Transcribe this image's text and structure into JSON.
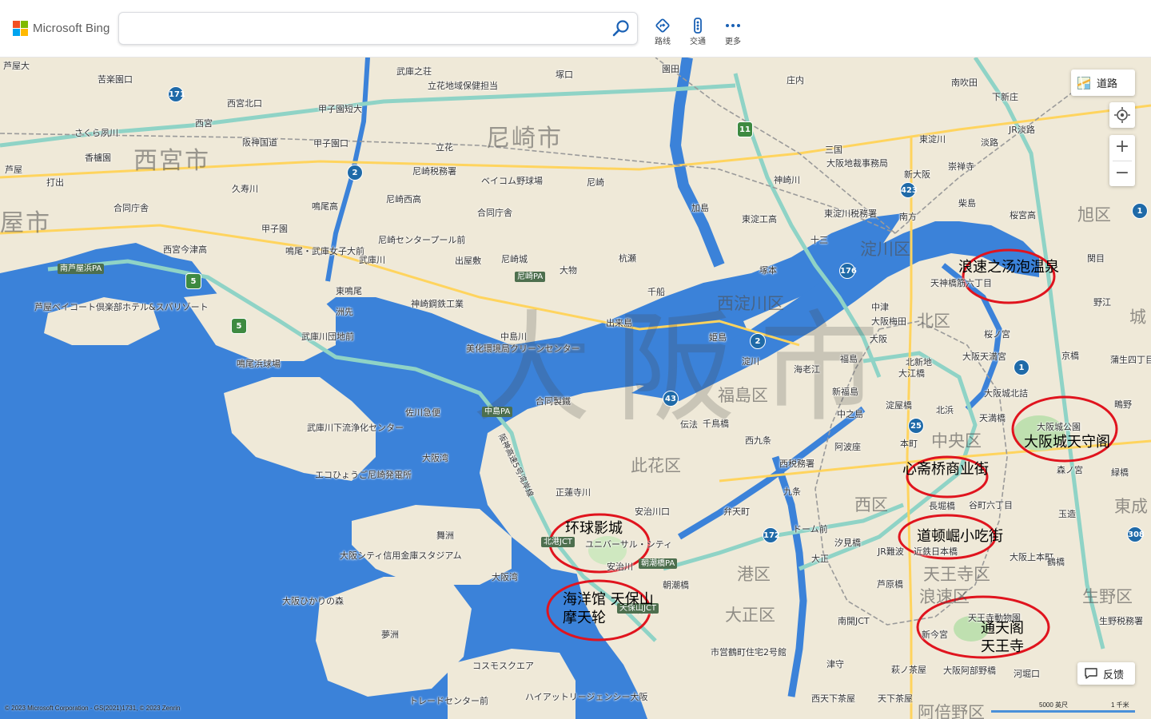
{
  "header": {
    "brand": "Microsoft Bing",
    "brand_colors": [
      "#f25022",
      "#7fba00",
      "#00a4ef",
      "#ffb900"
    ],
    "search": {
      "value": "",
      "placeholder": ""
    },
    "search_icon": "search-icon",
    "buttons": [
      {
        "label": "路线",
        "icon": "directions-icon"
      },
      {
        "label": "交通",
        "icon": "traffic-icon"
      },
      {
        "label": "更多",
        "icon": "more-icon"
      }
    ]
  },
  "map": {
    "style_button": "道路",
    "feedback": "反馈",
    "copyright": "© 2023 Microsoft Corporation - GS(2021)1731, © 2023 Zenrin",
    "scale": {
      "imperial": "5000 英尺",
      "metric": "1 千米"
    },
    "watermark": "大阪市",
    "cities": [
      "西宮市",
      "尼崎市",
      "屋市"
    ],
    "wards": [
      "淀川区",
      "西淀川区",
      "北区",
      "旭区",
      "城",
      "福島区",
      "中央区",
      "此花区",
      "西区",
      "東成",
      "港区",
      "天王寺区",
      "浪速区",
      "大正区",
      "生野区",
      "阿倍野区"
    ],
    "places": [
      "芦屋大",
      "苦楽園口",
      "西宮北口",
      "甲子園短大",
      "武庫之荘",
      "立花地域保健担当",
      "塚口",
      "園田",
      "豊中IC(JCT)",
      "庄内",
      "南吹田",
      "下新庄",
      "瑞光四丁目",
      "さくら夙川",
      "西宮",
      "阪神国道",
      "甲子園口",
      "立花",
      "尼崎税務署",
      "ベイコム野球場",
      "尼崎",
      "加島",
      "東淀工高",
      "神崎川",
      "三国",
      "大阪地裁事務局",
      "東淀川",
      "崇禅寺",
      "淡路",
      "JR淡路",
      "芦屋",
      "香櫨園",
      "打出",
      "久寿川",
      "鳴尾高",
      "尼崎西高",
      "合同庁舎",
      "新大阪",
      "柴島",
      "桜宮高",
      "合同庁舎",
      "甲子園",
      "鳴尾・武庫女子大前",
      "武庫川",
      "尼崎センタープール前",
      "出屋敷",
      "尼崎城",
      "杭瀬",
      "大物",
      "千船",
      "十三",
      "南方",
      "東淀川税務署",
      "塚本",
      "関目",
      "西宮今津高",
      "東鳴尾",
      "洲先",
      "神崎鋼鉄工業",
      "中津",
      "天神橋筋六丁目",
      "野江",
      "芦屋ベイコート倶楽部ホテル&スパリゾート",
      "武庫川団地前",
      "中島川",
      "美化環境局クリーンセンター",
      "出来島",
      "姫島",
      "大阪梅田",
      "大阪",
      "桜ノ宮",
      "京橋",
      "蒲生四丁目",
      "鳴尾浜球場",
      "淀川",
      "海老江",
      "北新地",
      "福島",
      "大江橋",
      "新福島",
      "大阪天満宮",
      "大阪城北詰",
      "鴫野",
      "合同製鐵",
      "佐川急便",
      "伝法",
      "千鳥橋",
      "中之島",
      "淀屋橋",
      "北浜",
      "天満橋",
      "大阪城公園",
      "武庫川下流浄化センター",
      "大阪湾",
      "西九条",
      "阿波座",
      "本町",
      "森ノ宮",
      "緑橋",
      "エコひょうご尼崎発電所",
      "西税務署",
      "九条",
      "正蓮寺川",
      "弁天町",
      "長堀橋",
      "谷町六丁目",
      "舞洲",
      "安治川口",
      "ドーム前",
      "玉造",
      "ユニバーサル・シティ",
      "朝潮橋",
      "汐見橋",
      "大阪上本町",
      "鶴橋",
      "大阪シティ信用金庫スタジアム",
      "大阪湾",
      "安治川",
      "大正",
      "JR難波",
      "近鉄日本橋",
      "大阪ひかりの森",
      "天保山",
      "芦原橋",
      "大阪・海遊館",
      "木津川",
      "天王寺動物園",
      "生野税務署",
      "夢洲",
      "新今宮",
      "南開JCT",
      "コスモスクエア",
      "市営鶴町住宅2号館",
      "津守",
      "萩ノ茶屋",
      "大阪阿部野橋",
      "河堀口",
      "トレードセンター前",
      "ハイアットリージェンシー大阪",
      "西天下茶屋",
      "天下茶屋"
    ],
    "pa_labels": [
      "南芦屋浜PA",
      "尼崎PA",
      "中島PA",
      "北港JCT",
      "朝潮橋PA",
      "天保山JCT",
      "阪神高速5号湾岸線"
    ],
    "route_shields": [
      "171",
      "2",
      "5",
      "5",
      "11",
      "423",
      "176",
      "2",
      "43",
      "25",
      "1",
      "1",
      "172",
      "308"
    ],
    "annotations": [
      {
        "text": "浪速之汤泡温泉"
      },
      {
        "text": "大阪城天守阁"
      },
      {
        "text": "心斋桥商业街"
      },
      {
        "text": "环球影城"
      },
      {
        "text": "道顿崛小吃街"
      },
      {
        "text": "海洋馆 天保山摩天轮"
      },
      {
        "text": "通天阁 天王寺"
      }
    ],
    "colors": {
      "water": "#3b82d9",
      "land": "#efe9d8",
      "expressway": "#8fd3c6",
      "annotation_ring": "#e0141e"
    }
  }
}
